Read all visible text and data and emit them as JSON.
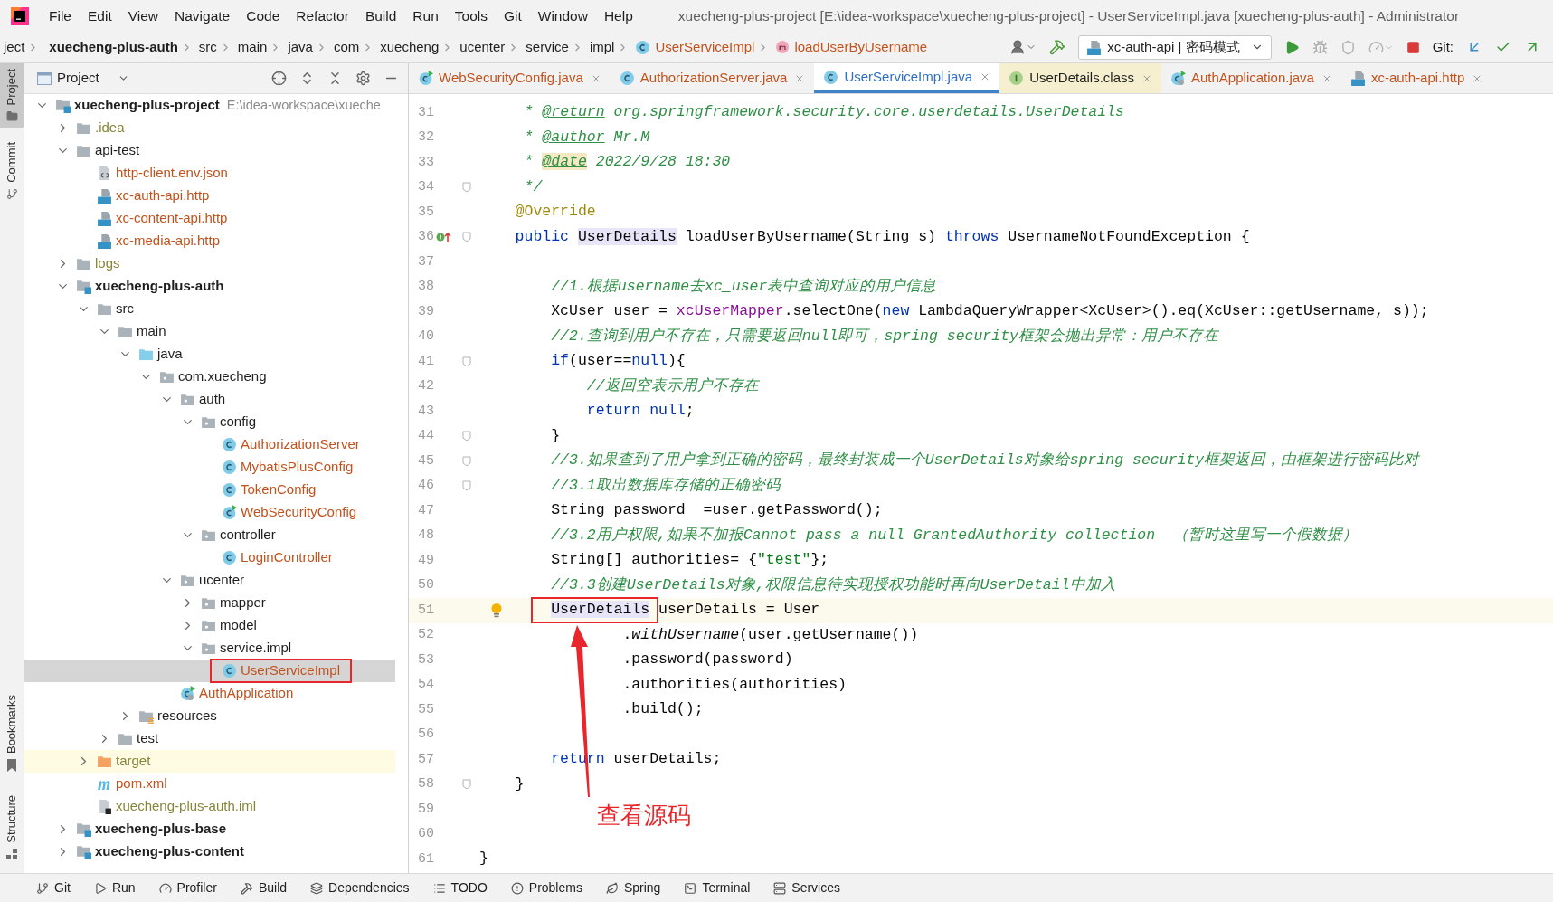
{
  "menu": {
    "items": [
      "File",
      "Edit",
      "View",
      "Navigate",
      "Code",
      "Refactor",
      "Build",
      "Run",
      "Tools",
      "Git",
      "Window",
      "Help"
    ],
    "title": "xuecheng-plus-project [E:\\idea-workspace\\xuecheng-plus-project] - UserServiceImpl.java [xuecheng-plus-auth] - Administrator"
  },
  "breadcrumbs": [
    {
      "label": "ject",
      "kind": "plain"
    },
    {
      "label": "xuecheng-plus-auth",
      "kind": "module"
    },
    {
      "label": "src",
      "kind": "plain"
    },
    {
      "label": "main",
      "kind": "plain"
    },
    {
      "label": "java",
      "kind": "plain"
    },
    {
      "label": "com",
      "kind": "plain"
    },
    {
      "label": "xuecheng",
      "kind": "plain"
    },
    {
      "label": "ucenter",
      "kind": "plain"
    },
    {
      "label": "service",
      "kind": "plain"
    },
    {
      "label": "impl",
      "kind": "plain"
    },
    {
      "label": "UserServiceImpl",
      "kind": "class"
    },
    {
      "label": "loadUserByUsername",
      "kind": "method"
    }
  ],
  "run_config": {
    "label": "xc-auth-api | 密码模式"
  },
  "git_label": "Git:",
  "project_panel": {
    "title": "Project"
  },
  "side_tabs_top": [
    {
      "label": "Project",
      "selected": true
    },
    {
      "label": "Commit",
      "selected": false
    }
  ],
  "side_tabs_bottom": [
    {
      "label": "Bookmarks",
      "selected": false
    },
    {
      "label": "Structure",
      "selected": false
    }
  ],
  "tree": [
    {
      "label": "xuecheng-plus-project",
      "path": "E:\\idea-workspace\\xueche",
      "kind": "module",
      "untracked": false,
      "ignored": false,
      "expanded": true,
      "selected": false,
      "children": [
        {
          "label": ".idea",
          "kind": "folder",
          "untracked": false,
          "ignored": true,
          "expanded": false,
          "selected": false
        },
        {
          "label": "api-test",
          "kind": "folder",
          "untracked": false,
          "ignored": false,
          "expanded": true,
          "selected": false,
          "children": [
            {
              "label": "http-client.env.json",
              "kind": "json",
              "untracked": true,
              "ignored": false,
              "selected": false
            },
            {
              "label": "xc-auth-api.http",
              "kind": "api",
              "untracked": true,
              "ignored": false,
              "selected": false
            },
            {
              "label": "xc-content-api.http",
              "kind": "api",
              "untracked": true,
              "ignored": false,
              "selected": false
            },
            {
              "label": "xc-media-api.http",
              "kind": "api",
              "untracked": true,
              "ignored": false,
              "selected": false
            }
          ]
        },
        {
          "label": "logs",
          "kind": "folder",
          "untracked": false,
          "ignored": true,
          "expanded": false,
          "selected": false
        },
        {
          "label": "xuecheng-plus-auth",
          "kind": "module",
          "untracked": false,
          "ignored": false,
          "expanded": true,
          "selected": false,
          "children": [
            {
              "label": "src",
              "kind": "folder",
              "untracked": false,
              "ignored": false,
              "expanded": true,
              "selected": false,
              "children": [
                {
                  "label": "main",
                  "kind": "folder",
                  "untracked": false,
                  "ignored": false,
                  "expanded": true,
                  "selected": false,
                  "children": [
                    {
                      "label": "java",
                      "kind": "source",
                      "untracked": false,
                      "ignored": false,
                      "expanded": true,
                      "selected": false,
                      "children": [
                        {
                          "label": "com.xuecheng",
                          "kind": "package",
                          "untracked": false,
                          "ignored": false,
                          "expanded": true,
                          "selected": false,
                          "children": [
                            {
                              "label": "auth",
                              "kind": "package",
                              "untracked": false,
                              "ignored": false,
                              "expanded": true,
                              "selected": false,
                              "children": [
                                {
                                  "label": "config",
                                  "kind": "package",
                                  "untracked": false,
                                  "ignored": false,
                                  "expanded": true,
                                  "selected": false,
                                  "children": [
                                    {
                                      "label": "AuthorizationServer",
                                      "kind": "class",
                                      "untracked": true,
                                      "ignored": false,
                                      "selected": false
                                    },
                                    {
                                      "label": "MybatisPlusConfig",
                                      "kind": "class",
                                      "untracked": true,
                                      "ignored": false,
                                      "selected": false
                                    },
                                    {
                                      "label": "TokenConfig",
                                      "kind": "class",
                                      "untracked": true,
                                      "ignored": false,
                                      "selected": false
                                    },
                                    {
                                      "label": "WebSecurityConfig",
                                      "kind": "runclass",
                                      "untracked": true,
                                      "ignored": false,
                                      "selected": false
                                    }
                                  ]
                                },
                                {
                                  "label": "controller",
                                  "kind": "package",
                                  "untracked": false,
                                  "ignored": false,
                                  "expanded": true,
                                  "selected": false,
                                  "children": [
                                    {
                                      "label": "LoginController",
                                      "kind": "class",
                                      "untracked": true,
                                      "ignored": false,
                                      "selected": false
                                    }
                                  ]
                                }
                              ]
                            },
                            {
                              "label": "ucenter",
                              "kind": "package",
                              "untracked": false,
                              "ignored": false,
                              "expanded": true,
                              "selected": false,
                              "children": [
                                {
                                  "label": "mapper",
                                  "kind": "package",
                                  "untracked": false,
                                  "ignored": false,
                                  "expanded": false,
                                  "selected": false
                                },
                                {
                                  "label": "model",
                                  "kind": "package",
                                  "untracked": false,
                                  "ignored": false,
                                  "expanded": false,
                                  "selected": false
                                },
                                {
                                  "label": "service.impl",
                                  "kind": "package",
                                  "untracked": false,
                                  "ignored": false,
                                  "expanded": true,
                                  "selected": false,
                                  "children": [
                                    {
                                      "label": "UserServiceImpl",
                                      "kind": "class",
                                      "untracked": true,
                                      "ignored": false,
                                      "selected": true,
                                      "boxed": true
                                    }
                                  ]
                                }
                              ]
                            },
                            {
                              "label": "AuthApplication",
                              "kind": "spring",
                              "untracked": true,
                              "ignored": false,
                              "selected": false
                            }
                          ]
                        }
                      ]
                    },
                    {
                      "label": "resources",
                      "kind": "resources",
                      "untracked": false,
                      "ignored": false,
                      "expanded": false,
                      "selected": false
                    }
                  ]
                },
                {
                  "label": "test",
                  "kind": "folder",
                  "untracked": false,
                  "ignored": false,
                  "expanded": false,
                  "selected": false
                }
              ]
            },
            {
              "label": "target",
              "kind": "excluded",
              "untracked": false,
              "ignored": true,
              "expanded": false,
              "selected": false,
              "highlighted": true
            },
            {
              "label": "pom.xml",
              "kind": "maven",
              "untracked": true,
              "ignored": false,
              "selected": false
            },
            {
              "label": "xuecheng-plus-auth.iml",
              "kind": "iml",
              "untracked": false,
              "ignored": true,
              "selected": false
            }
          ]
        },
        {
          "label": "xuecheng-plus-base",
          "kind": "module",
          "untracked": false,
          "ignored": false,
          "expanded": false,
          "selected": false
        },
        {
          "label": "xuecheng-plus-content",
          "kind": "module",
          "untracked": false,
          "ignored": false,
          "expanded": false,
          "selected": false
        }
      ]
    }
  ],
  "tabs": [
    {
      "label": "WebSecurityConfig.java",
      "kind": "runclass",
      "untracked": true,
      "library": false,
      "selected": false
    },
    {
      "label": "AuthorizationServer.java",
      "kind": "class",
      "untracked": true,
      "library": false,
      "selected": false
    },
    {
      "label": "UserServiceImpl.java",
      "kind": "class",
      "untracked": true,
      "library": false,
      "selected": true
    },
    {
      "label": "UserDetails.class",
      "kind": "interface",
      "untracked": false,
      "library": true,
      "selected": false
    },
    {
      "label": "AuthApplication.java",
      "kind": "spring",
      "untracked": true,
      "library": false,
      "selected": false
    },
    {
      "label": "xc-auth-api.http",
      "kind": "api",
      "untracked": true,
      "library": false,
      "selected": false
    }
  ],
  "code": [
    {
      "number": "31",
      "fold": false,
      "current": false,
      "tokens": [
        {
          "text": "     * ",
          "kind": "doc"
        },
        {
          "text": "@return",
          "kind": "tag"
        },
        {
          "text": " org.springframework.security.core.userdetails.UserDetails",
          "kind": "doc"
        }
      ]
    },
    {
      "number": "32",
      "fold": false,
      "current": false,
      "tokens": [
        {
          "text": "     * ",
          "kind": "doc"
        },
        {
          "text": "@author",
          "kind": "tag"
        },
        {
          "text": " Mr.M",
          "kind": "doc"
        }
      ]
    },
    {
      "number": "33",
      "fold": false,
      "current": false,
      "tokens": [
        {
          "text": "     * ",
          "kind": "doc"
        },
        {
          "text": "@date",
          "kind": "tagmark"
        },
        {
          "text": " 2022/9/28 18:30",
          "kind": "doc"
        }
      ]
    },
    {
      "number": "34",
      "fold": true,
      "current": false,
      "tokens": [
        {
          "text": "     */",
          "kind": "doc"
        }
      ]
    },
    {
      "number": "35",
      "fold": false,
      "current": false,
      "tokens": [
        {
          "text": "    @Override",
          "kind": "annotation"
        }
      ]
    },
    {
      "number": "36",
      "fold": true,
      "current": false,
      "kind": "implements",
      "tokens": [
        {
          "text": "    public ",
          "kind": "keyword"
        },
        {
          "text": "UserDetails",
          "kind": "usage"
        },
        {
          "text": " loadUserByUsername(String s) ",
          "kind": "plain"
        },
        {
          "text": "throws",
          "kind": "keyword"
        },
        {
          "text": " UsernameNotFoundException {",
          "kind": "plain"
        }
      ]
    },
    {
      "number": "37",
      "fold": false,
      "current": false
    },
    {
      "number": "38",
      "fold": false,
      "current": false,
      "tokens": [
        {
          "text": "        //1.根据username去xc_user表中查询对应的用户信息",
          "kind": "comment"
        }
      ]
    },
    {
      "number": "39",
      "fold": false,
      "current": false,
      "tokens": [
        {
          "text": "        XcUser user = ",
          "kind": "plain"
        },
        {
          "text": "xcUserMapper",
          "kind": "field"
        },
        {
          "text": ".selectOne(",
          "kind": "plain"
        },
        {
          "text": "new",
          "kind": "keyword"
        },
        {
          "text": " LambdaQueryWrapper<XcUser>().eq(XcUser::getUsername, s));",
          "kind": "plain"
        }
      ]
    },
    {
      "number": "40",
      "fold": false,
      "current": false,
      "tokens": [
        {
          "text": "        //2.查询到用户不存在，只需要返回null即可，spring security框架会抛出异常：用户不存在",
          "kind": "comment"
        }
      ]
    },
    {
      "number": "41",
      "fold": true,
      "current": false,
      "tokens": [
        {
          "text": "        if",
          "kind": "keyword"
        },
        {
          "text": "(user==",
          "kind": "plain"
        },
        {
          "text": "null",
          "kind": "keyword"
        },
        {
          "text": "){",
          "kind": "plain"
        }
      ]
    },
    {
      "number": "42",
      "fold": false,
      "current": false,
      "tokens": [
        {
          "text": "            //返回空表示用户不存在",
          "kind": "comment"
        }
      ]
    },
    {
      "number": "43",
      "fold": false,
      "current": false,
      "tokens": [
        {
          "text": "            return ",
          "kind": "keyword"
        },
        {
          "text": "null",
          "kind": "keyword"
        },
        {
          "text": ";",
          "kind": "plain"
        }
      ]
    },
    {
      "number": "44",
      "fold": true,
      "current": false,
      "tokens": [
        {
          "text": "        }",
          "kind": "plain"
        }
      ]
    },
    {
      "number": "45",
      "fold": true,
      "current": false,
      "tokens": [
        {
          "text": "        //3.如果查到了用户拿到正确的密码，最终封装成一个UserDetails对象给spring security框架返回，由框架进行密码比对",
          "kind": "comment"
        }
      ]
    },
    {
      "number": "46",
      "fold": true,
      "current": false,
      "tokens": [
        {
          "text": "        //3.1取出数据库存储的正确密码",
          "kind": "comment"
        }
      ]
    },
    {
      "number": "47",
      "fold": false,
      "current": false,
      "tokens": [
        {
          "text": "        String password  =user.getPassword();",
          "kind": "plain"
        }
      ]
    },
    {
      "number": "48",
      "fold": false,
      "current": false,
      "tokens": [
        {
          "text": "        //3.2用户权限,如果不加报Cannot pass a null GrantedAuthority collection  （暂时这里写一个假数据）",
          "kind": "comment"
        }
      ]
    },
    {
      "number": "49",
      "fold": false,
      "current": false,
      "tokens": [
        {
          "text": "        String[] authorities= {",
          "kind": "plain"
        },
        {
          "text": "\"test\"",
          "kind": "string"
        },
        {
          "text": "};",
          "kind": "plain"
        }
      ]
    },
    {
      "number": "50",
      "fold": false,
      "current": false,
      "tokens": [
        {
          "text": "        //3.3创建UserDetails对象,权限信息待实现授权功能时再向UserDetail中加入",
          "kind": "comment"
        }
      ]
    },
    {
      "number": "51",
      "fold": false,
      "current": true,
      "kind": "bulb",
      "tokens": [
        {
          "text": "        UserDetails",
          "kind": "usage",
          "boxed": true
        },
        {
          "text": " userDetails = User",
          "kind": "plain"
        }
      ]
    },
    {
      "number": "52",
      "fold": false,
      "current": false,
      "tokens": [
        {
          "text": "                .",
          "kind": "plain"
        },
        {
          "text": "withUsername",
          "kind": "call"
        },
        {
          "text": "(user.getUsername())",
          "kind": "plain"
        }
      ]
    },
    {
      "number": "53",
      "fold": false,
      "current": false,
      "tokens": [
        {
          "text": "                .password(password)",
          "kind": "plain"
        }
      ]
    },
    {
      "number": "54",
      "fold": false,
      "current": false,
      "tokens": [
        {
          "text": "                .authorities(authorities)",
          "kind": "plain"
        }
      ]
    },
    {
      "number": "55",
      "fold": false,
      "current": false,
      "tokens": [
        {
          "text": "                .build();",
          "kind": "plain"
        }
      ]
    },
    {
      "number": "56",
      "fold": false,
      "current": false
    },
    {
      "number": "57",
      "fold": false,
      "current": false,
      "tokens": [
        {
          "text": "        return",
          "kind": "keyword"
        },
        {
          "text": " userDetails;",
          "kind": "plain"
        }
      ]
    },
    {
      "number": "58",
      "fold": true,
      "current": false,
      "tokens": [
        {
          "text": "    }",
          "kind": "plain"
        }
      ]
    },
    {
      "number": "59",
      "fold": false,
      "current": false
    },
    {
      "number": "60",
      "fold": false,
      "current": false
    },
    {
      "number": "61",
      "fold": false,
      "current": false,
      "tokens": [
        {
          "text": "}",
          "kind": "plain"
        }
      ]
    }
  ],
  "annotation": {
    "text": "查看源码"
  },
  "bottom_tools": [
    {
      "label": "Git"
    },
    {
      "label": "Run"
    },
    {
      "label": "Profiler"
    },
    {
      "label": "Build"
    },
    {
      "label": "Dependencies"
    },
    {
      "label": "TODO"
    },
    {
      "label": "Problems"
    },
    {
      "label": "Spring"
    },
    {
      "label": "Terminal"
    },
    {
      "label": "Services"
    }
  ]
}
